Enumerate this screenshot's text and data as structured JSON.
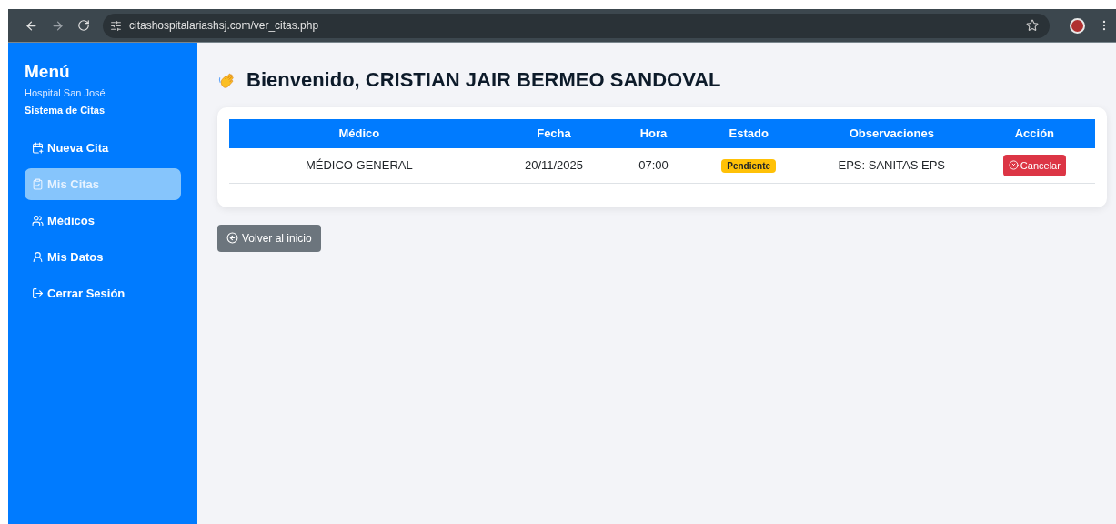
{
  "browser": {
    "url": "citashospitalariashsj.com/ver_citas.php"
  },
  "sidebar": {
    "title": "Menú",
    "subtitle": "Hospital San José",
    "system": "Sistema de Citas",
    "items": [
      {
        "label": "Nueva Cita",
        "kind": "calendar",
        "selected": false
      },
      {
        "label": "Mis Citas",
        "kind": "clipboard",
        "selected": true
      },
      {
        "label": "Médicos",
        "kind": "people",
        "selected": false
      },
      {
        "label": "Mis Datos",
        "kind": "person",
        "selected": false
      },
      {
        "label": "Cerrar Sesión",
        "kind": "logout",
        "selected": false
      }
    ]
  },
  "heading": "Bienvenido, CRISTIAN JAIR BERMEO SANDOVAL",
  "table": {
    "columns": [
      "Médico",
      "Fecha",
      "Hora",
      "Estado",
      "Observaciones",
      "Acción"
    ],
    "rows": [
      {
        "medico": "MÉDICO GENERAL",
        "fecha": "20/11/2025",
        "hora": "07:00",
        "estado": "Pendiente",
        "color": "#ffc107",
        "observaciones": "EPS: SANITAS EPS",
        "action": "Cancelar"
      }
    ]
  },
  "back_button": "Volver al inicio"
}
